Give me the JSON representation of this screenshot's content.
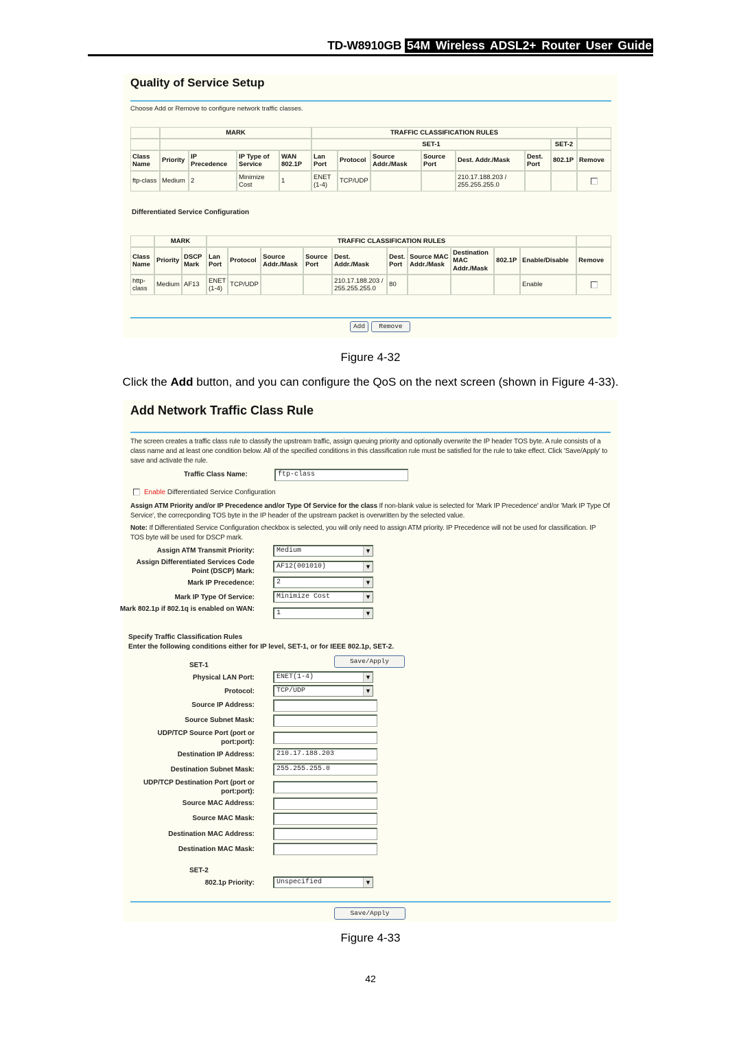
{
  "header": {
    "model": "TD-W8910GB",
    "guide": "54M Wireless ADSL2+ Router User Guide"
  },
  "figure1": {
    "title": "Quality of Service Setup",
    "instruction": "Choose Add or Remove to configure network traffic classes.",
    "qos_table": {
      "group_mark": "MARK",
      "group_rules": "TRAFFIC CLASSIFICATION RULES",
      "set1": "SET-1",
      "set2": "SET-2",
      "columns": [
        "Class Name",
        "Priority",
        "IP Precedence",
        "IP Type of Service",
        "WAN 802.1P",
        "Lan Port",
        "Protocol",
        "Source Addr./Mask",
        "Source Port",
        "Dest. Addr./Mask",
        "Dest. Port",
        "802.1P",
        "Remove"
      ],
      "rows": [
        {
          "class_name": "ftp-class",
          "priority": "Medium",
          "ip_precedence": "2",
          "ip_tos": "Minimize Cost",
          "wan_8021p": "1",
          "lan_port": "ENET (1-4)",
          "protocol": "TCP/UDP",
          "src_addr": "",
          "src_port": "",
          "dest_addr": "210.17.188.203 / 255.255.255.0",
          "dest_port": "",
          "p8021": "",
          "remove_checked": false
        }
      ]
    },
    "diffserv_title": "Differentiated Service Configuration",
    "diffserv_table": {
      "group_mark": "MARK",
      "group_rules": "TRAFFIC CLASSIFICATION RULES",
      "columns": [
        "Class Name",
        "Priority",
        "DSCP Mark",
        "Lan Port",
        "Protocol",
        "Source Addr./Mask",
        "Source Port",
        "Dest. Addr./Mask",
        "Dest. Port",
        "Source MAC Addr./Mask",
        "Destination MAC Addr./Mask",
        "802.1P",
        "Enable/Disable",
        "Remove"
      ],
      "rows": [
        {
          "class_name": "http-class",
          "priority": "Medium",
          "dscp": "AF13",
          "lan_port": "ENET (1-4)",
          "protocol": "TCP/UDP",
          "src_addr": "",
          "src_port": "",
          "dest_addr": "210.17.188.203 / 255.255.255.0",
          "dest_port": "80",
          "src_mac": "",
          "dst_mac": "",
          "p8021": "",
          "enable": "Enable",
          "remove_checked": false
        }
      ]
    },
    "add_button": "Add",
    "remove_button": "Remove",
    "caption": "Figure 4-32"
  },
  "body": {
    "pre": "Click the ",
    "bold": "Add",
    "post": " button, and you can configure the QoS on the next screen (shown in Figure 4-33)."
  },
  "figure2": {
    "title": "Add Network Traffic Class Rule",
    "intro": "The screen creates a traffic class rule to classify the upstream traffic, assign queuing priority and optionally overwrite the IP header TOS byte. A rule consists of a class name and at least one condition below. All of the specified conditions in this classification rule must be satisfied for the rule to take effect. Click 'Save/Apply' to save and activate the rule.",
    "traffic_class_name_label": "Traffic Class Name:",
    "traffic_class_name_value": "ftp-class",
    "enable_checked": false,
    "enable_word": "Enable",
    "enable_rest": " Differentiated Service Configuration",
    "assign_bold": "Assign ATM Priority and/or IP Precedence and/or Type Of Service for the class",
    "assign_rest": " If non-blank value is selected for 'Mark IP Precedence' and/or 'Mark IP Type Of Service', the correcponding TOS byte in the IP header of the upstream packet is overwritten by the selected value.",
    "note_bold": "Note:",
    "note_rest": " If Differentiated Service Configuration checkbox is selected, you will only need to assign ATM priority. IP Precedence will not be used for classification. IP TOS byte will be used for DSCP mark.",
    "fields": [
      {
        "label": "Assign ATM Transmit Priority:",
        "value": "Medium"
      },
      {
        "label": "Assign Differentiated Services Code Point (DSCP) Mark:",
        "value": "AF12(001010)"
      },
      {
        "label": "Mark IP Precedence:",
        "value": "2"
      },
      {
        "label": "Mark IP Type Of Service:",
        "value": "Minimize Cost"
      },
      {
        "label": "Mark 802.1p if 802.1q is enabled on WAN:",
        "value": "1"
      }
    ],
    "specify_title": "Specify Traffic Classification Rules",
    "specify_sub": "Enter the following conditions either for IP level, SET-1, or for IEEE 802.1p, SET-2.",
    "save_apply": "Save/Apply",
    "set1_label": "SET-1",
    "set1": [
      {
        "label": "Physical LAN Port:",
        "value": "ENET(1-4)",
        "type": "select"
      },
      {
        "label": "Protocol:",
        "value": "TCP/UDP",
        "type": "select"
      },
      {
        "label": "Source IP Address:",
        "value": "",
        "type": "input"
      },
      {
        "label": "Source Subnet Mask:",
        "value": "",
        "type": "input"
      },
      {
        "label": "UDP/TCP Source Port (port or port:port):",
        "value": "",
        "type": "input"
      },
      {
        "label": "Destination IP Address:",
        "value": "210.17.188.203",
        "type": "input"
      },
      {
        "label": "Destination Subnet Mask:",
        "value": "255.255.255.0",
        "type": "input"
      },
      {
        "label": "UDP/TCP Destination Port (port or port:port):",
        "value": "",
        "type": "input"
      },
      {
        "label": "Source MAC Address:",
        "value": "",
        "type": "input"
      },
      {
        "label": "Source MAC Mask:",
        "value": "",
        "type": "input"
      },
      {
        "label": "Destination MAC Address:",
        "value": "",
        "type": "input"
      },
      {
        "label": "Destination MAC Mask:",
        "value": "",
        "type": "input"
      }
    ],
    "set2_label": "SET-2",
    "set2": [
      {
        "label": "802.1p Priority:",
        "value": "Unspecified",
        "type": "select"
      }
    ],
    "save_apply_bottom": "Save/Apply",
    "caption": "Figure 4-33"
  },
  "page_number": "42"
}
